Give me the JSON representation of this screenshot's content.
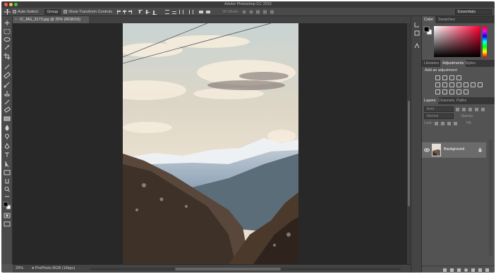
{
  "app": {
    "title": "Adobe Photoshop CC 2015"
  },
  "options_bar": {
    "auto_select_label": "Auto-Select:",
    "auto_select_value": "Group",
    "show_transform_label": "Show Transform Controls",
    "mode_3d_label": "3D Mode:",
    "workspace": "Essentials"
  },
  "document": {
    "tab_title": "IC_MG_3173.jpg @ 25% (RGB/16)",
    "zoom": "25%",
    "profile": "ProPhoto RGB (16bpc)"
  },
  "panels": {
    "color_group": {
      "tabs": [
        "Color",
        "Swatches"
      ],
      "active": "Color"
    },
    "adjust_group": {
      "tabs": [
        "Libraries",
        "Adjustments",
        "Styles"
      ],
      "active": "Adjustments",
      "heading": "Add an adjustment",
      "icons": [
        "brightness-contrast-icon",
        "levels-icon",
        "curves-icon",
        "exposure-icon",
        "vibrance-icon",
        "hue-saturation-icon",
        "color-balance-icon",
        "black-white-icon",
        "photo-filter-icon",
        "channel-mixer-icon",
        "color-lookup-icon",
        "invert-icon",
        "posterize-icon",
        "threshold-icon",
        "gradient-map-icon",
        "selective-color-icon"
      ]
    },
    "layers_group": {
      "tabs": [
        "Layers",
        "Channels",
        "Paths"
      ],
      "active": "Layers",
      "kind_placeholder": "Kind",
      "blend_mode": "Normal",
      "opacity_label": "Opacity:",
      "lock_label": "Lock:",
      "fill_label": "Fill:",
      "layers": [
        {
          "name": "Background",
          "visible": true,
          "locked": true
        }
      ]
    }
  },
  "tools": [
    "move-tool-icon",
    "marquee-tool-icon",
    "lasso-tool-icon",
    "quick-select-tool-icon",
    "crop-tool-icon",
    "eyedropper-tool-icon",
    "healing-brush-tool-icon",
    "brush-tool-icon",
    "clone-stamp-tool-icon",
    "history-brush-tool-icon",
    "eraser-tool-icon",
    "gradient-tool-icon",
    "blur-tool-icon",
    "dodge-tool-icon",
    "pen-tool-icon",
    "type-tool-icon",
    "path-select-tool-icon",
    "rectangle-tool-icon",
    "hand-tool-icon",
    "zoom-tool-icon",
    "more-tools-icon"
  ],
  "colors": {
    "foreground": "#000000",
    "background": "#ffffff",
    "canvas_bg": "#282828",
    "ui_bg": "#535353"
  }
}
